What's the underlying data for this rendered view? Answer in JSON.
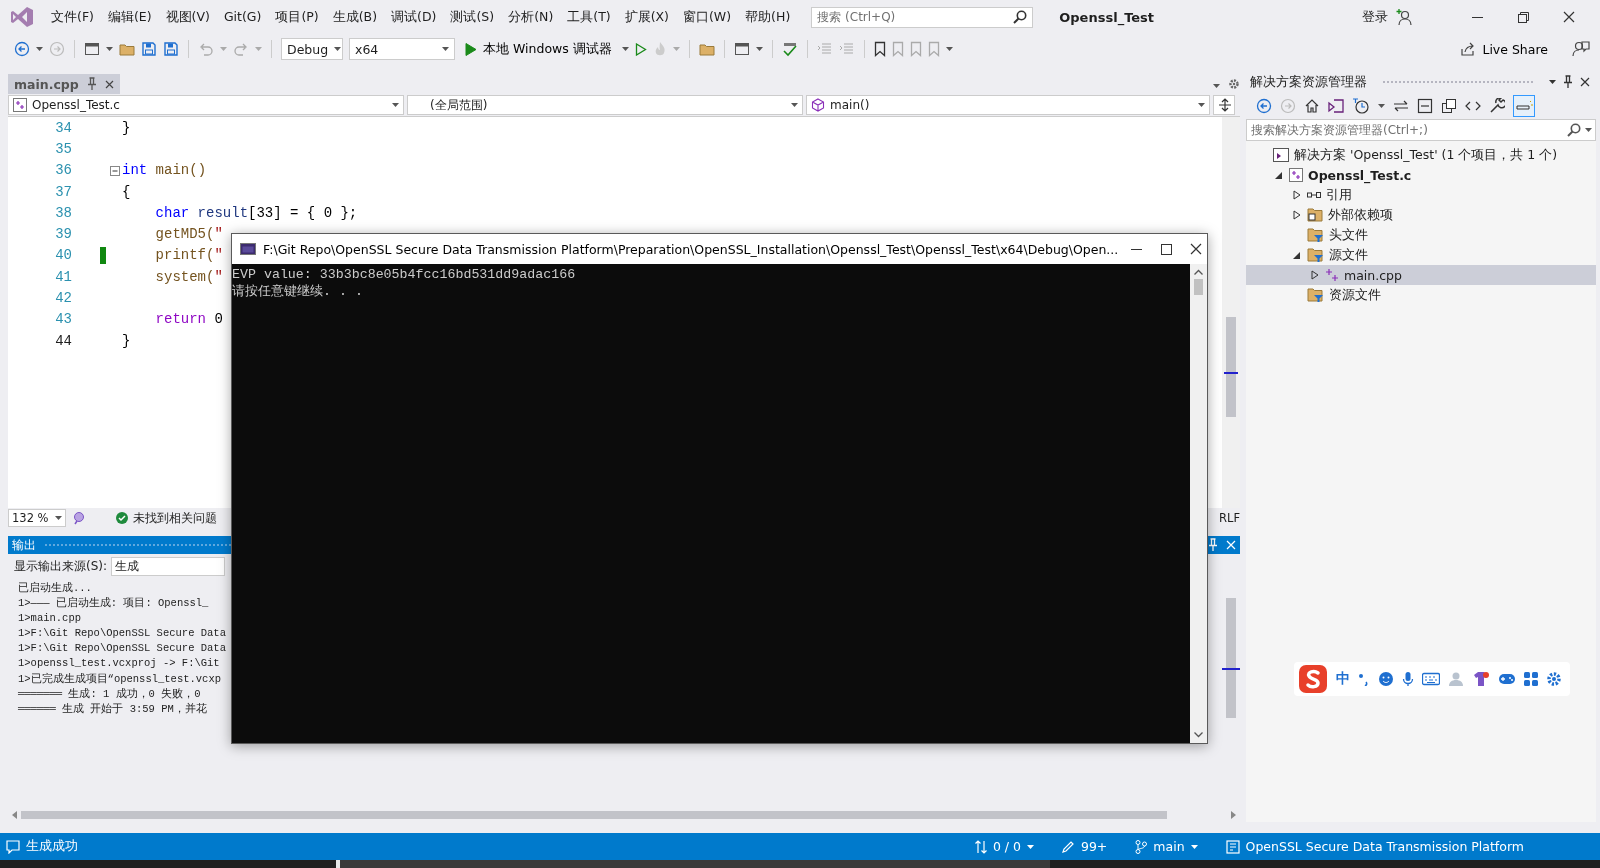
{
  "window": {
    "title": "Openssl_Test",
    "search_placeholder": "搜索 (Ctrl+Q)",
    "account": "登录",
    "live_share": "Live Share"
  },
  "menu": [
    "文件(F)",
    "编辑(E)",
    "视图(V)",
    "Git(G)",
    "项目(P)",
    "生成(B)",
    "调试(D)",
    "测试(S)",
    "分析(N)",
    "工具(T)",
    "扩展(X)",
    "窗口(W)",
    "帮助(H)"
  ],
  "toolbar": {
    "configuration": "Debug",
    "platform": "x64",
    "run": "本地 Windows 调试器"
  },
  "document_tabs": [
    {
      "label": "main.cpp",
      "selected": true
    }
  ],
  "navigation": {
    "project": "Openssl_Test.c",
    "scope": "(全局范围)",
    "member": "main()"
  },
  "editor": {
    "zoom": "132 %",
    "issues": "未找到相关问题",
    "line_ending": "RLF",
    "lines": [
      {
        "number": "34",
        "current": false,
        "changed": false,
        "foldable": false,
        "tokens": [
          {
            "text": "}",
            "kind": "plain"
          }
        ]
      },
      {
        "number": "35",
        "current": false,
        "changed": false,
        "foldable": false
      },
      {
        "number": "36",
        "current": false,
        "changed": false,
        "foldable": true,
        "tokens": [
          {
            "text": "int",
            "kind": "keyword"
          },
          {
            "text": " main()",
            "kind": "function"
          }
        ]
      },
      {
        "number": "37",
        "current": false,
        "changed": false,
        "foldable": false,
        "tokens": [
          {
            "text": "{",
            "kind": "plain"
          }
        ]
      },
      {
        "number": "38",
        "current": false,
        "changed": false,
        "foldable": false,
        "tokens": [
          {
            "text": "    char",
            "kind": "keyword"
          },
          {
            "text": " result",
            "kind": "variable"
          },
          {
            "text": "[33] = { 0 };",
            "kind": "plain"
          }
        ]
      },
      {
        "number": "39",
        "current": false,
        "changed": false,
        "foldable": false,
        "tokens": [
          {
            "text": "    getMD5(",
            "kind": "function"
          },
          {
            "text": "\"",
            "kind": "string"
          }
        ]
      },
      {
        "number": "40",
        "current": false,
        "changed": true,
        "foldable": false,
        "tokens": [
          {
            "text": "    printf(",
            "kind": "function"
          },
          {
            "text": "\"",
            "kind": "string"
          }
        ]
      },
      {
        "number": "41",
        "current": false,
        "changed": false,
        "foldable": false,
        "tokens": [
          {
            "text": "    system(",
            "kind": "function"
          },
          {
            "text": "\"",
            "kind": "string"
          }
        ]
      },
      {
        "number": "42",
        "current": false,
        "changed": false,
        "foldable": false
      },
      {
        "number": "43",
        "current": false,
        "changed": false,
        "foldable": false,
        "tokens": [
          {
            "text": "    return",
            "kind": "control"
          },
          {
            "text": " 0",
            "kind": "plain"
          }
        ]
      },
      {
        "number": "44",
        "current": true,
        "changed": false,
        "foldable": false,
        "tokens": [
          {
            "text": "}",
            "kind": "plain"
          }
        ]
      }
    ]
  },
  "output": {
    "title": "输出",
    "source_label": "显示输出来源(S):",
    "source": "生成",
    "lines": [
      "已启动生成...",
      "1>——— 已启动生成: 项目: Openssl_",
      "1>main.cpp",
      "1>F:\\Git Repo\\OpenSSL Secure Data",
      "1>F:\\Git Repo\\OpenSSL Secure Data",
      "1>openssl_test.vcxproj -> F:\\Git",
      "1>已完成生成项目“openssl_test.vcxp",
      "═══════ 生成: 1 成功，0 失败，0",
      "══════ 生成 开始于 3:59 PM，并花"
    ]
  },
  "solution_explorer": {
    "title": "解决方案资源管理器",
    "search_placeholder": "搜索解决方案资源管理器(Ctrl+;)",
    "tree": [
      {
        "label": "解决方案 'Openssl_Test' (1 个项目，共 1 个)",
        "kind": "solution",
        "expandable": false,
        "selected": false,
        "children": [
          {
            "label": "Openssl_Test.c",
            "kind": "project",
            "expandable": true,
            "expanded": true,
            "selected": false,
            "children": [
              {
                "label": "引用",
                "kind": "references",
                "expandable": true,
                "expanded": false,
                "selected": false
              },
              {
                "label": "外部依赖项",
                "kind": "external",
                "expandable": true,
                "expanded": false,
                "selected": false
              },
              {
                "label": "头文件",
                "kind": "filter",
                "expandable": false,
                "selected": false
              },
              {
                "label": "源文件",
                "kind": "filter",
                "expandable": true,
                "expanded": true,
                "selected": false,
                "children": [
                  {
                    "label": "main.cpp",
                    "kind": "file",
                    "expandable": true,
                    "expanded": false,
                    "selected": true
                  }
                ]
              },
              {
                "label": "资源文件",
                "kind": "filter",
                "expandable": false,
                "selected": false
              }
            ]
          }
        ]
      }
    ]
  },
  "console": {
    "title": "F:\\Git Repo\\OpenSSL Secure Data Transmission Platform\\Preparation\\OpenSSL_Installation\\Openssl_Test\\Openssl_Test\\x64\\Debug\\Open...",
    "lines": [
      "EVP value: 33b3bc8e05b4fcc16bd531dd9adac166",
      "请按任意键继续. . ."
    ]
  },
  "ime_toolbar": {
    "mode": "中"
  },
  "status_bar": {
    "message": "生成成功",
    "changes": "0 / 0",
    "edits": "99+",
    "branch": "main",
    "repository": "OpenSSL Secure Data Transmission Platform"
  }
}
